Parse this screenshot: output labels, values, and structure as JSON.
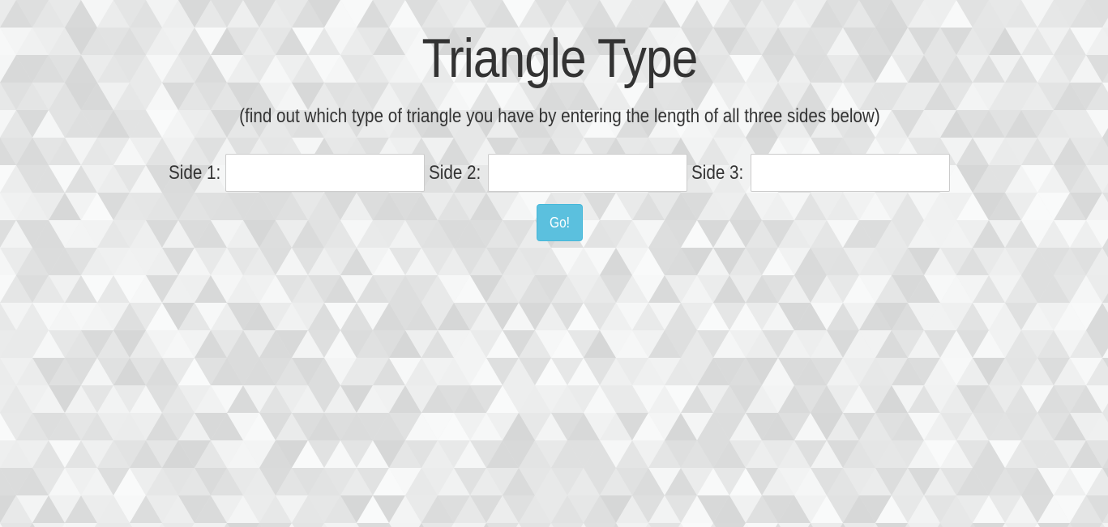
{
  "page": {
    "title": "Triangle Type",
    "subtitle": "(find out which type of triangle you have by entering the length of all three sides below)"
  },
  "form": {
    "fields": [
      {
        "label": "Side 1:",
        "value": "",
        "placeholder": ""
      },
      {
        "label": "Side 2:",
        "value": "",
        "placeholder": ""
      },
      {
        "label": "Side 3:",
        "value": "",
        "placeholder": ""
      }
    ],
    "submit_label": "Go!"
  },
  "colors": {
    "background": "#ebecec",
    "text": "#333333",
    "button": "#5bc0de",
    "button_border": "#46b8da",
    "button_text": "#ffffff",
    "input_border": "#cccccc"
  }
}
